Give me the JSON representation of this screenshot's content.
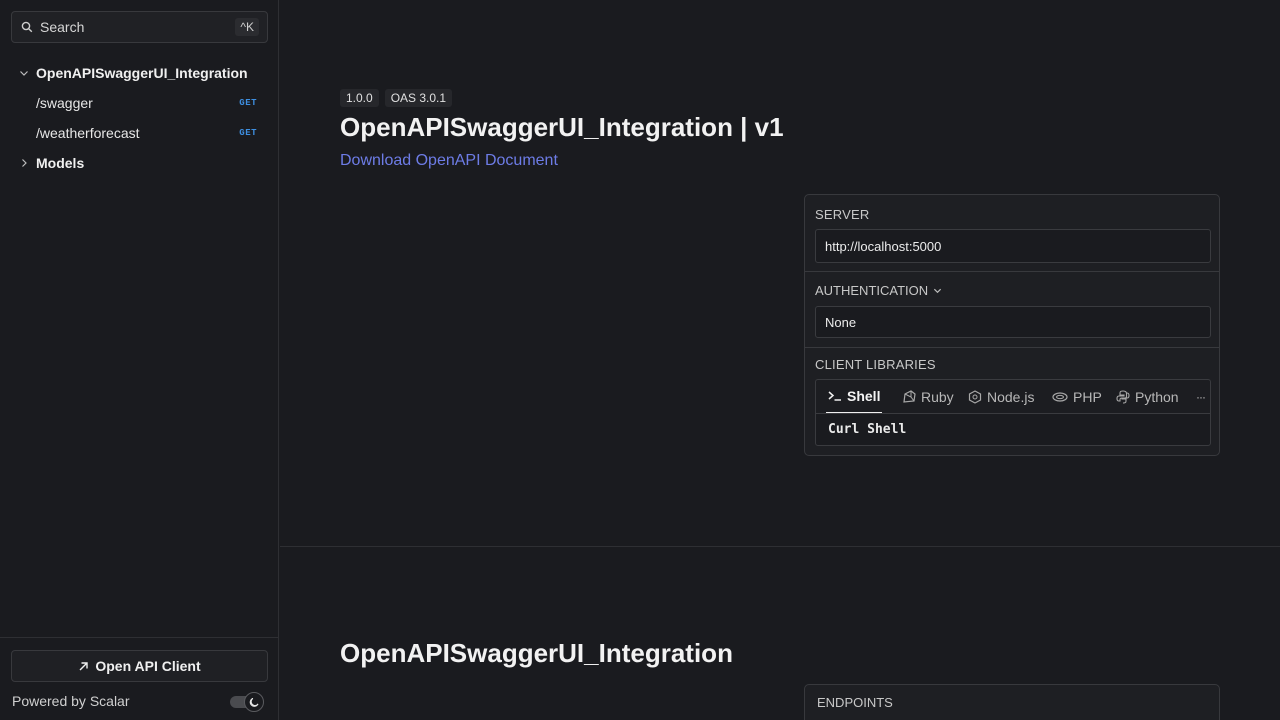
{
  "search": {
    "label": "Search",
    "shortcut": "^K"
  },
  "sidebar": {
    "group": "OpenAPISwaggerUI_Integration",
    "items": [
      {
        "label": "/swagger",
        "method": "GET"
      },
      {
        "label": "/weatherforecast",
        "method": "GET"
      }
    ],
    "models": "Models",
    "client_button": "Open API Client",
    "powered_by": "Powered by Scalar"
  },
  "info": {
    "version": "1.0.0",
    "oas": "OAS 3.0.1",
    "title": "OpenAPISwaggerUI_Integration | v1",
    "download": "Download OpenAPI Document"
  },
  "panel": {
    "server_label": "SERVER",
    "server_value": "http://localhost:5000",
    "auth_label": "AUTHENTICATION",
    "auth_value": "None",
    "client_libraries_label": "CLIENT LIBRARIES",
    "tabs": [
      "Shell",
      "Ruby",
      "Node.js",
      "PHP",
      "Python"
    ],
    "more": "···",
    "code": "Curl Shell"
  },
  "section": {
    "title": "OpenAPISwaggerUI_Integration",
    "endpoints_label": "ENDPOINTS"
  },
  "colors": {
    "background": "#1a1b1f",
    "link": "#6d7ce6",
    "method_get": "#3e8fe0"
  }
}
